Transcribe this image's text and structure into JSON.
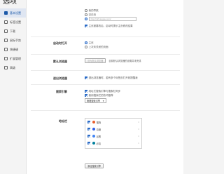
{
  "header": {
    "title": "选项"
  },
  "sidebar": {
    "items": [
      {
        "label": "基本设置",
        "icon": "gear-icon",
        "active": true
      },
      {
        "label": "标签设置",
        "icon": "tab-icon"
      },
      {
        "label": "下载",
        "icon": "download-icon"
      },
      {
        "label": "鼠标手势",
        "icon": "mouse-icon"
      },
      {
        "label": "快捷键",
        "icon": "keyboard-icon"
      },
      {
        "label": "扩展管理",
        "icon": "puzzle-icon"
      },
      {
        "label": "高级",
        "icon": "more-icon"
      }
    ]
  },
  "homepage": {
    "options": [
      "我的导航",
      "空白页",
      "自定义"
    ],
    "custom_url": "http://123.sogou.com/",
    "tamper_check_label": "主页被篡改后，启动时提示主页修改结果"
  },
  "startup": {
    "label": "启动时打开",
    "options": [
      "主页",
      "上次未关闭的页面"
    ]
  },
  "default_browser": {
    "label": "默认浏览器",
    "button_label": "设为默认浏览器",
    "status_text": "目前默认浏览器的设置并未完成"
  },
  "exit_browser": {
    "label": "退出浏览器",
    "check_label": "退出浏览器时，若有多个标签页打开则提醒我"
  },
  "search_engine": {
    "label": "搜索引擎",
    "options": [
      "地址栏搜索引擎与搜索栏同步",
      "使用搜索栏的热词推荐"
    ],
    "manage_button": "管理搜索引擎",
    "dropdown_caret": "▼"
  },
  "address_bar": {
    "label": "地址栏",
    "engines": [
      {
        "name": "搜狗",
        "color": "#e85f2d"
      },
      {
        "name": "百度",
        "color": "#2d5fe8"
      },
      {
        "name": "谷歌",
        "color": "#4285f4"
      },
      {
        "name": "必应",
        "color": "#00809d"
      }
    ],
    "close_glyph": "×",
    "add_button": "添加搜索引擎"
  }
}
